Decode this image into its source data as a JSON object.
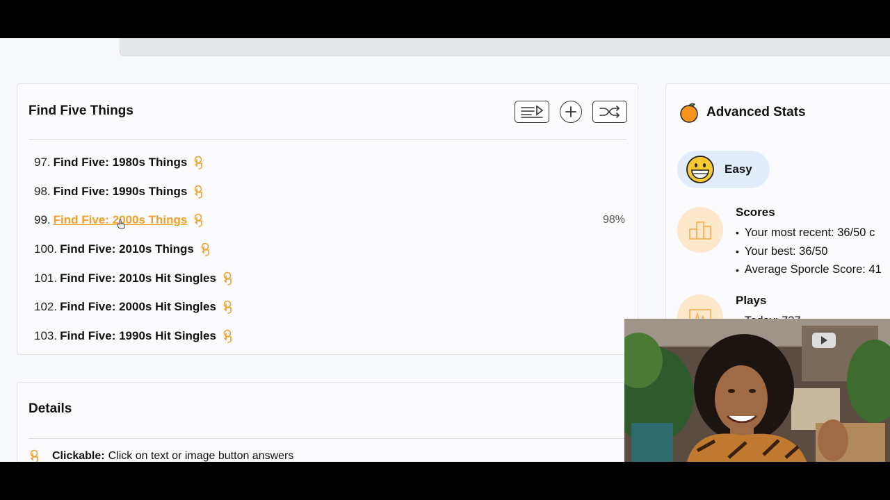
{
  "colors": {
    "accent_orange": "#f0a12a",
    "pill_blue": "#e3ecfb",
    "icon_peach": "#fde8cc",
    "strip_red": "#d9413a",
    "strip_green": "#3aa346"
  },
  "list_card": {
    "title": "Find Five Things",
    "toolbar": [
      "playlist-icon",
      "add-icon",
      "shuffle-icon"
    ],
    "items": [
      {
        "num": "97.",
        "title": "Find Five: 1980s Things",
        "pct": "",
        "active": false
      },
      {
        "num": "98.",
        "title": "Find Five: 1990s Things",
        "pct": "",
        "active": false
      },
      {
        "num": "99.",
        "title": "Find Five: 2000s Things",
        "pct": "98%",
        "active": true
      },
      {
        "num": "100.",
        "title": "Find Five: 2010s Things",
        "pct": "",
        "active": false
      },
      {
        "num": "101.",
        "title": "Find Five: 2010s Hit Singles",
        "pct": "",
        "active": false
      },
      {
        "num": "102.",
        "title": "Find Five: 2000s Hit Singles",
        "pct": "",
        "active": false
      },
      {
        "num": "103.",
        "title": "Find Five: 1990s Hit Singles",
        "pct": "",
        "active": false
      }
    ]
  },
  "details_card": {
    "title": "Details",
    "clickable_label": "Clickable:",
    "clickable_text": "Click on text or image button answers"
  },
  "stats_card": {
    "title": "Advanced Stats",
    "difficulty": "Easy",
    "scores_heading": "Scores",
    "scores": [
      "Your most recent: 36/50 c",
      "Your best: 36/50",
      "Average Sporcle Score: 41"
    ],
    "plays_heading": "Plays",
    "plays": [
      "Today: 737"
    ]
  }
}
